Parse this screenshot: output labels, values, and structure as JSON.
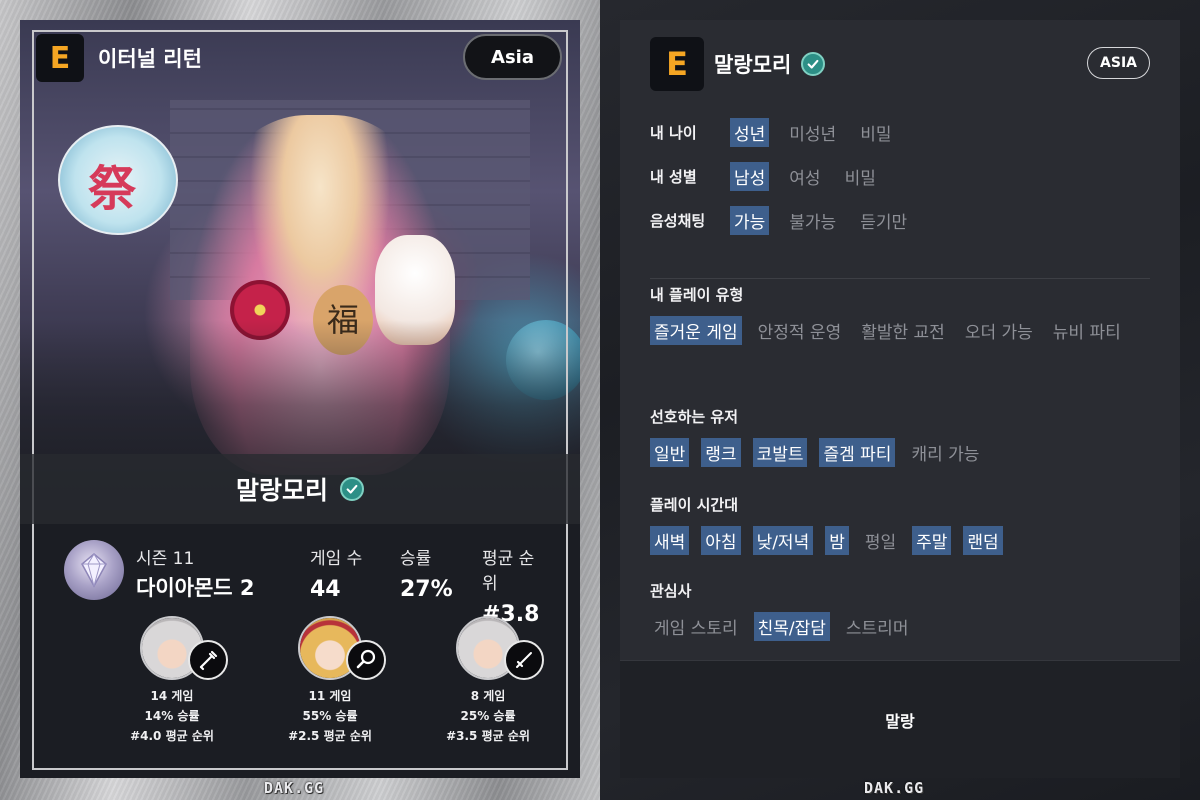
{
  "left_card": {
    "game_title": "이터널 리턴",
    "logo_letter": "E",
    "region": "Asia",
    "nickname": "말랑모리",
    "season": "시즌 11",
    "tier": "다이아몬드 2",
    "stats": [
      {
        "label": "게임 수",
        "value": "44"
      },
      {
        "label": "승률",
        "value": "27%"
      },
      {
        "label": "평균 순위",
        "value": "#3.8"
      }
    ],
    "characters": [
      {
        "games": "14 게임",
        "winrate": "14% 승률",
        "avg_rank": "#4.0 평균 순위",
        "weapon_icon": "dagger-icon"
      },
      {
        "games": "11 게임",
        "winrate": "55% 승률",
        "avg_rank": "#2.5 평균 순위",
        "weapon_icon": "racket-icon"
      },
      {
        "games": "8 게임",
        "winrate": "25% 승률",
        "avg_rank": "#3.5 평균 순위",
        "weapon_icon": "sword-icon"
      }
    ],
    "watermark": "DAK.GG"
  },
  "right_card": {
    "logo_letter": "E",
    "nickname": "말랑모리",
    "region": "ASIA",
    "my_age": {
      "label": "내 나이",
      "options": [
        {
          "text": "성년",
          "on": true
        },
        {
          "text": "미성년",
          "on": false
        },
        {
          "text": "비밀",
          "on": false
        }
      ]
    },
    "my_gender": {
      "label": "내 성별",
      "options": [
        {
          "text": "남성",
          "on": true
        },
        {
          "text": "여성",
          "on": false
        },
        {
          "text": "비밀",
          "on": false
        }
      ]
    },
    "voice_chat": {
      "label": "음성채팅",
      "options": [
        {
          "text": "가능",
          "on": true
        },
        {
          "text": "불가능",
          "on": false
        },
        {
          "text": "듣기만",
          "on": false
        }
      ]
    },
    "play_style": {
      "label": "내 플레이 유형",
      "options": [
        {
          "text": "즐거운 게임",
          "on": true
        },
        {
          "text": "안정적 운영",
          "on": false
        },
        {
          "text": "활발한 교전",
          "on": false
        },
        {
          "text": "오더 가능",
          "on": false
        },
        {
          "text": "뉴비 파티",
          "on": false
        }
      ]
    },
    "preferred_users": {
      "label": "선호하는 유저",
      "options": [
        {
          "text": "일반",
          "on": true
        },
        {
          "text": "랭크",
          "on": true
        },
        {
          "text": "코발트",
          "on": true
        },
        {
          "text": "즐겜 파티",
          "on": true
        },
        {
          "text": "캐리 가능",
          "on": false
        }
      ]
    },
    "play_time": {
      "label": "플레이 시간대",
      "options": [
        {
          "text": "새벽",
          "on": true
        },
        {
          "text": "아침",
          "on": true
        },
        {
          "text": "낮/저녁",
          "on": true
        },
        {
          "text": "밤",
          "on": true
        },
        {
          "text": "평일",
          "on": false
        },
        {
          "text": "주말",
          "on": true
        },
        {
          "text": "랜덤",
          "on": true
        }
      ]
    },
    "interests": {
      "label": "관심사",
      "options": [
        {
          "text": "게임 스토리",
          "on": false
        },
        {
          "text": "친목/잡담",
          "on": true
        },
        {
          "text": "스트리머",
          "on": false
        }
      ]
    },
    "footer_text": "말랑",
    "watermark": "DAK.GG"
  },
  "colors": {
    "chip_on": "#3e5f8c",
    "chip_off_text": "#8e9097",
    "verify": "#2d8f86",
    "logo_accent": "#f5a623"
  }
}
